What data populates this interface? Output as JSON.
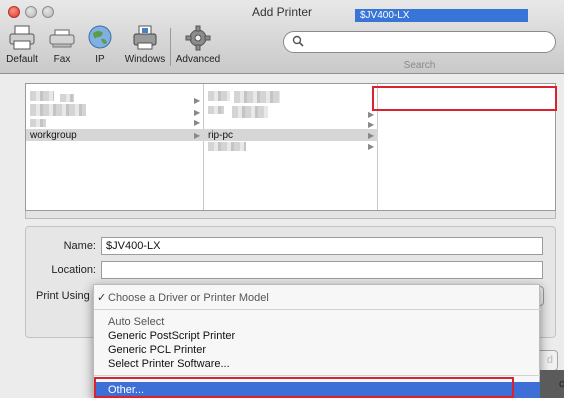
{
  "window": {
    "title": "Add Printer"
  },
  "toolbar": {
    "buttons": [
      {
        "label": "Default",
        "icon": "printer-icon"
      },
      {
        "label": "Fax",
        "icon": "fax-icon"
      },
      {
        "label": "IP",
        "icon": "globe-icon"
      },
      {
        "label": "Windows",
        "icon": "windows-printer-icon"
      },
      {
        "label": "Advanced",
        "icon": "gear-icon"
      }
    ],
    "search": {
      "placeholder": "",
      "caption": "Search"
    }
  },
  "browser": {
    "column1": {
      "items": [
        "workgroup"
      ]
    },
    "column2": {
      "items": [
        "rip-pc"
      ]
    },
    "column3": {
      "items": [
        "$JV400-LX"
      ]
    }
  },
  "form": {
    "name_label": "Name:",
    "name_value": "$JV400-LX",
    "location_label": "Location:",
    "location_value": "",
    "print_using_label": "Print Using",
    "add_button_fragment": "d"
  },
  "menu": {
    "checked_item": "Choose a Driver or Printer Model",
    "check_mark": "✓",
    "items": [
      "Auto Select",
      "Generic PostScript Printer",
      "Generic PCL Printer",
      "Select Printer Software...",
      "Other..."
    ],
    "selected_index": 4
  },
  "colors": {
    "highlight": "#3875d7",
    "annotation_red": "#d9232e"
  },
  "edge_fragment": "c"
}
